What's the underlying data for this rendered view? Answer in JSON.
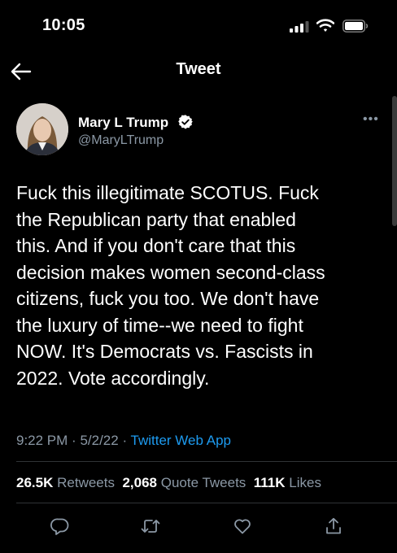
{
  "status_bar": {
    "time": "10:05"
  },
  "nav": {
    "title": "Tweet"
  },
  "tweet": {
    "author_name": "Mary L Trump",
    "handle": "@MaryLTrump",
    "text": "Fuck this illegitimate SCOTUS. Fuck\nthe Republican party that enabled\nthis. And if you don't care that this\ndecision makes women second-class\ncitizens, fuck you too. We don't have\nthe luxury of time--we need to fight\nNOW. It's Democrats vs. Fascists in\n2022. Vote accordingly.",
    "time": "9:22 PM",
    "date": "5/2/22",
    "source": "Twitter Web App"
  },
  "stats": {
    "retweets_count": "26.5K",
    "retweets_label": "Retweets",
    "quotes_count": "2,068",
    "quotes_label": "Quote Tweets",
    "likes_count": "111K",
    "likes_label": "Likes"
  },
  "icons": [
    "back-arrow-icon",
    "signal-icon",
    "wifi-icon",
    "battery-icon",
    "verified-icon",
    "more-icon",
    "reply-icon",
    "retweet-icon",
    "like-icon",
    "share-icon"
  ],
  "colors": {
    "background": "#000000",
    "accent": "#1d9bf0",
    "secondary_text": "#8b98a5",
    "divider": "#2f3336"
  }
}
